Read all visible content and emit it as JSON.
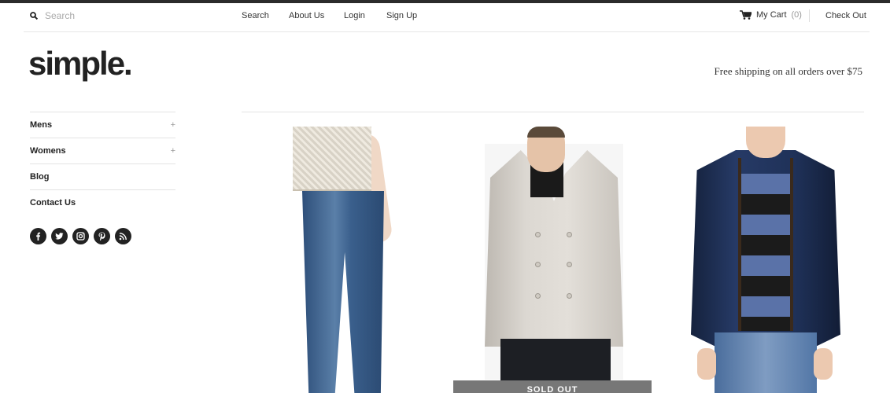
{
  "header": {
    "search_placeholder": "Search",
    "nav": [
      "Search",
      "About Us",
      "Login",
      "Sign Up"
    ],
    "cart_label": "My Cart",
    "cart_count": "(0)",
    "checkout_label": "Check Out"
  },
  "brand": {
    "logo_text": "simple.",
    "tagline": "Free shipping on all orders over $75"
  },
  "sidebar": {
    "items": [
      {
        "label": "Mens",
        "expand": "+"
      },
      {
        "label": "Womens",
        "expand": "+"
      },
      {
        "label": "Blog",
        "expand": ""
      },
      {
        "label": "Contact Us",
        "expand": ""
      }
    ],
    "social": [
      "facebook-icon",
      "twitter-icon",
      "instagram-icon",
      "pinterest-icon",
      "rss-icon"
    ]
  },
  "products": [
    {
      "name": "jeans-product"
    },
    {
      "name": "peacoat-product",
      "badge": "SOLD OUT"
    },
    {
      "name": "navy-jacket-product"
    }
  ],
  "colors": {
    "top_border": "#2b2b2b",
    "text": "#222222",
    "divider": "#e3e3e3",
    "soldout_bg": "#777777"
  }
}
